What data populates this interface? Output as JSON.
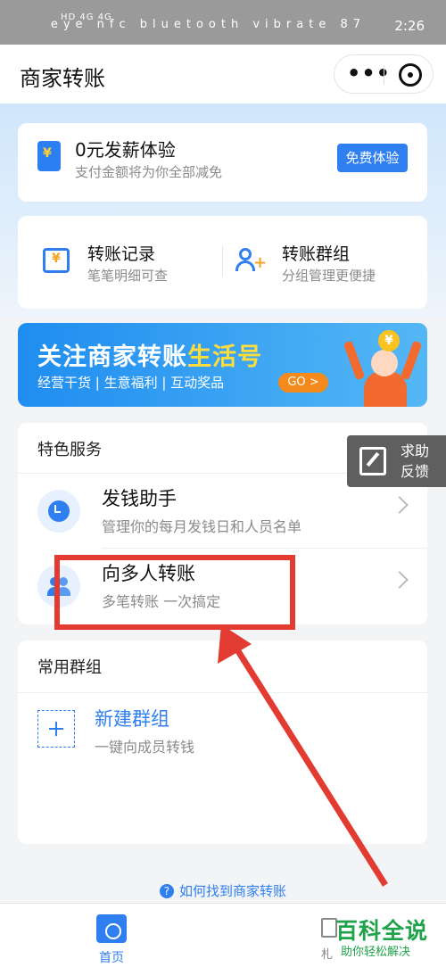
{
  "status_bar": {
    "left_indicators": "HD 4G 4G",
    "right_icons": "eye nfc bluetooth vibrate 87",
    "time": "2:26"
  },
  "nav": {
    "title": "商家转账",
    "more_icon": "more-dots-icon",
    "close_icon": "close-capsule-icon"
  },
  "promo": {
    "title": "0元发薪体验",
    "subtitle": "支付金额将为你全部减免",
    "button": "免费体验",
    "icon": "payroll-icon"
  },
  "quick": [
    {
      "title": "转账记录",
      "subtitle": "笔笔明细可查",
      "icon": "calendar-yuan-icon"
    },
    {
      "title": "转账群组",
      "subtitle": "分组管理更便捷",
      "icon": "add-person-icon"
    }
  ],
  "banner": {
    "title_prefix": "关注商家转账",
    "title_highlight": "生活号",
    "subtitle": "经营干货 | 生意福利 | 互动奖品",
    "cta": "GO >",
    "coin": "¥"
  },
  "services": {
    "title": "特色服务",
    "items": [
      {
        "title": "发钱助手",
        "subtitle": "管理你的每月发钱日和人员名单",
        "icon": "alarm-clock-icon"
      },
      {
        "title": "向多人转账",
        "subtitle": "多笔转账 一次搞定",
        "icon": "people-icon"
      }
    ]
  },
  "help": {
    "label": "求助反馈",
    "icon": "edit-feedback-icon"
  },
  "groups": {
    "title": "常用群组",
    "new_title": "新建群组",
    "new_subtitle": "一键向成员转钱",
    "icon": "plus-icon"
  },
  "howto": {
    "text": "如何找到商家转账",
    "icon": "question-icon"
  },
  "tabs": [
    {
      "label": "首页",
      "icon": "shop-icon"
    },
    {
      "label": "札",
      "icon": "document-icon"
    }
  ],
  "watermark": {
    "title": "百科全说",
    "subtitle": "助你轻松解决"
  },
  "colors": {
    "accent": "#2f7ff0",
    "annotation": "#e23b32",
    "watermark": "#1ea34a"
  }
}
